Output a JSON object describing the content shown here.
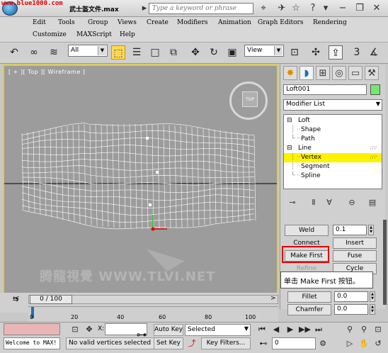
{
  "titlebar": {
    "url": "www.blue1000.com",
    "title": "武士盔文件.max",
    "search_placeholder": "Type a keyword or phrase"
  },
  "menu": {
    "row1": [
      "Edit",
      "Tools",
      "Group",
      "Views",
      "Create",
      "Modifiers",
      "Animation",
      "Graph Editors",
      "Rendering"
    ],
    "row2": [
      "Customize",
      "MAXScript",
      "Help"
    ]
  },
  "toolbar": {
    "filter_value": "All",
    "view_value": "View"
  },
  "viewport": {
    "label": "[ + ][ Top ][ Wireframe ]",
    "viewcube_label": "TOP",
    "watermark": "腾龍視覺 WWW.TLVI.NET"
  },
  "panel": {
    "object_name": "Loft001",
    "object_color": "#74e86c",
    "modifier_list": "Modifier List",
    "stack": [
      {
        "label": "Loft",
        "toggle": "⊟"
      },
      {
        "label": "Shape",
        "toggle": ""
      },
      {
        "label": "Path",
        "toggle": ""
      },
      {
        "label": "Line",
        "toggle": "⊟"
      },
      {
        "label": "Vertex",
        "toggle": ""
      },
      {
        "label": "Segment",
        "toggle": ""
      },
      {
        "label": "Spline",
        "toggle": ""
      }
    ],
    "weld_label": "Weld",
    "weld_value": "0.1",
    "connect_label": "Connect",
    "insert_label": "Insert",
    "make_first_label": "Make First",
    "fuse_label": "Fuse",
    "fillet_label": "Fillet",
    "fillet_value": "0.0",
    "chamfer_label": "Chamfer",
    "chamfer_value": "0.0",
    "partial_left": "Refine",
    "partial_right": "Cycle",
    "callout": "单击 Make First 按钮。"
  },
  "timeline": {
    "frame": "0 / 100",
    "ticks": [
      "0",
      "20",
      "40",
      "60",
      "80",
      "100"
    ]
  },
  "status": {
    "welcome": "Welcome to MAX!",
    "message": "No valid vertices selected",
    "x_label": "X:",
    "auto_key": "Auto Key",
    "set_key": "Set Key",
    "selected": "Selected",
    "key_filters": "Key Filters...",
    "frame_value": "0"
  },
  "colors": {
    "viewport_bg": "#9c9c9c",
    "viewport_border": "#e8d200",
    "highlight": "#e00000",
    "selected_stack": "#fff200"
  }
}
